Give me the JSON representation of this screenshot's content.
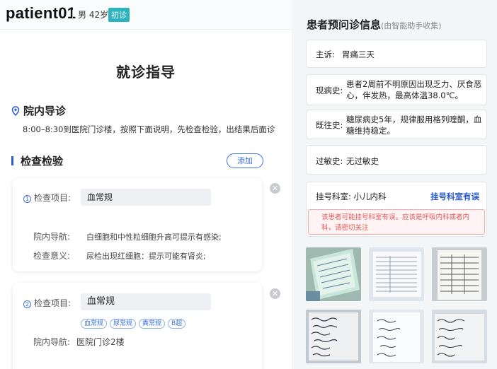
{
  "patient": {
    "name": "patient01",
    "gender_age": "男 42岁",
    "visit_type": "初诊"
  },
  "guide": {
    "title": "就诊指导",
    "section_nav": "院内导诊",
    "nav_text": "8:00–8:30到医院门诊楼，按照下面说明，先检查检验，出结果后面诊",
    "section_exam": "检查检验",
    "add_label": "添加"
  },
  "exam_items": [
    {
      "index": "1",
      "label": "检查项目:",
      "value": "血常规",
      "nav_label": "院内导航:",
      "nav_text": "白细胞和中性粒细胞升高可提示有感染;",
      "mean_label": "检查意义:",
      "mean_text": "尿检出现红细胞：提示可能有肾炎;"
    },
    {
      "index": "2",
      "label": "检查项目:",
      "value": "血常规",
      "tags": [
        "血常规",
        "尿常规",
        "粪常规",
        "B超"
      ],
      "nav_label": "院内导航:",
      "nav_text": "医院门诊2楼"
    }
  ],
  "pre_visit": {
    "title": "患者预问诊信息",
    "subtitle": "(由智能助手收集)",
    "chief_label": "主诉:",
    "chief": "胃痛三天",
    "present_label": "现病史:",
    "present": "患者2周前不明原因出现乏力、厌食恶心，伴发热，最高体温38.0℃。",
    "past_label": "既往史:",
    "past": "糖尿病史5年，规律服用格列喹酮，血糖维持稳定。",
    "allergy_label": "过敏史:",
    "allergy": "无过敏史",
    "dept_label": "挂号科室:",
    "dept": "小儿内科",
    "dept_link": "挂号科室有误",
    "warning": "该患者可能挂号科室有误，应该是呼吸内科或者内科，请密切关注"
  },
  "colors": {
    "accent": "#2a5bd7",
    "badge": "#2bb3c0",
    "warning": "#e25858"
  }
}
